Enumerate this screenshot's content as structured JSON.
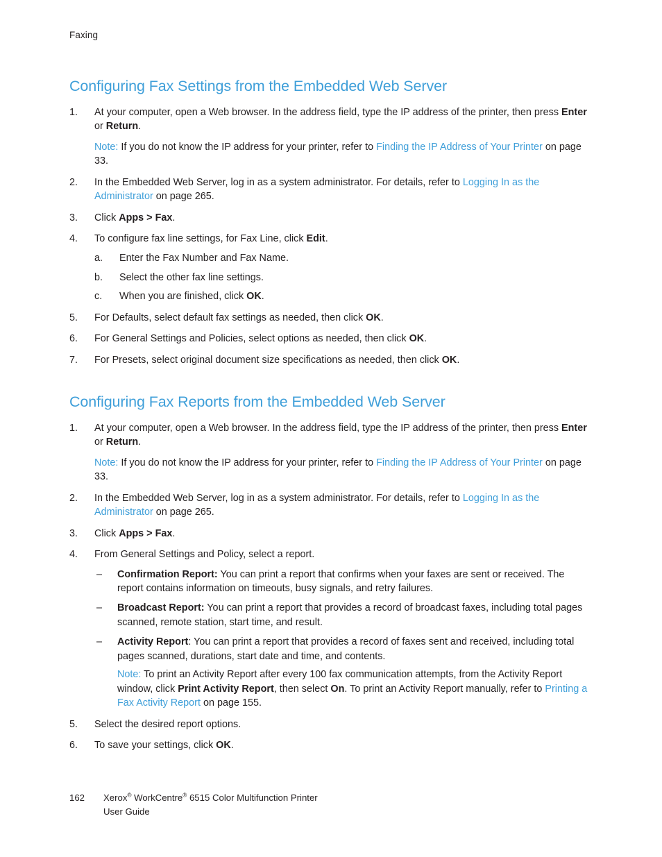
{
  "header": {
    "running_head": "Faxing"
  },
  "colors": {
    "heading_blue": "#3f9fd9",
    "link_blue": "#3f9fd9",
    "body_text": "#231f20"
  },
  "sections": [
    {
      "heading": "Configuring Fax Settings from the Embedded Web Server",
      "steps": [
        {
          "marker": "1.",
          "text_a": "At your computer, open a Web browser. In the address field, type the IP address of the printer, then press ",
          "bold_a": "Enter",
          "text_b": " or ",
          "bold_b": "Return",
          "text_c": ".",
          "note": {
            "label": "Note:",
            "text_a": " If you do not know the IP address for your printer, refer to ",
            "link": "Finding the IP Address of Your Printer",
            "text_b": " on page 33."
          }
        },
        {
          "marker": "2.",
          "text_a": "In the Embedded Web Server, log in as a system administrator. For details, refer to ",
          "link": "Logging In as the Administrator",
          "text_b": " on page 265."
        },
        {
          "marker": "3.",
          "text_a": "Click ",
          "bold_a": "Apps > Fax",
          "text_b": "."
        },
        {
          "marker": "4.",
          "text_a": "To configure fax line settings, for Fax Line, click ",
          "bold_a": "Edit",
          "text_b": ".",
          "substeps": [
            {
              "marker": "a.",
              "text_a": "Enter the Fax Number and Fax Name."
            },
            {
              "marker": "b.",
              "text_a": "Select the other fax line settings."
            },
            {
              "marker": "c.",
              "text_a": "When you are finished, click ",
              "bold_a": "OK",
              "text_b": "."
            }
          ]
        },
        {
          "marker": "5.",
          "text_a": "For Defaults, select default fax settings as needed, then click ",
          "bold_a": "OK",
          "text_b": "."
        },
        {
          "marker": "6.",
          "text_a": "For General Settings and Policies, select options as needed, then click ",
          "bold_a": "OK",
          "text_b": "."
        },
        {
          "marker": "7.",
          "text_a": "For Presets, select original document size specifications as needed, then click ",
          "bold_a": "OK",
          "text_b": "."
        }
      ]
    },
    {
      "heading": "Configuring Fax Reports from the Embedded Web Server",
      "steps": [
        {
          "marker": "1.",
          "text_a": "At your computer, open a Web browser. In the address field, type the IP address of the printer, then press ",
          "bold_a": "Enter",
          "text_b": " or ",
          "bold_b": "Return",
          "text_c": ".",
          "note": {
            "label": "Note:",
            "text_a": " If you do not know the IP address for your printer, refer to ",
            "link": "Finding the IP Address of Your Printer",
            "text_b": " on page 33."
          }
        },
        {
          "marker": "2.",
          "text_a": "In the Embedded Web Server, log in as a system administrator. For details, refer to ",
          "link": "Logging In as the Administrator",
          "text_b": " on page 265."
        },
        {
          "marker": "3.",
          "text_a": "Click ",
          "bold_a": "Apps > Fax",
          "text_b": "."
        },
        {
          "marker": "4.",
          "text_a": "From General Settings and Policy, select a report.",
          "bullets": [
            {
              "marker": "–",
              "bold_a": "Confirmation Report:",
              "text_a": " You can print a report that confirms when your faxes are sent or received. The report contains information on timeouts, busy signals, and retry failures."
            },
            {
              "marker": "–",
              "bold_a": "Broadcast Report:",
              "text_a": " You can print a report that provides a record of broadcast faxes, including total pages scanned, remote station, start time, and result."
            },
            {
              "marker": "–",
              "bold_a": "Activity Report",
              "text_a": ": You can print a report that provides a record of faxes sent and received, including total pages scanned, durations, start date and time, and contents.",
              "note": {
                "label": "Note:",
                "text_a": " To print an Activity Report after every 100 fax communication attempts, from the Activity Report window, click ",
                "bold_a": "Print Activity Report",
                "text_b": ", then select ",
                "bold_b": "On",
                "text_c": ". To print an Activity Report manually, refer to ",
                "link": "Printing a Fax Activity Report",
                "text_d": " on page 155."
              }
            }
          ]
        },
        {
          "marker": "5.",
          "text_a": "Select the desired report options."
        },
        {
          "marker": "6.",
          "text_a": "To save your settings, click ",
          "bold_a": "OK",
          "text_b": "."
        }
      ]
    }
  ],
  "footer": {
    "page_number": "162",
    "product_line_1_a": "Xerox",
    "product_line_1_sup1": "®",
    "product_line_1_b": " WorkCentre",
    "product_line_1_sup2": "®",
    "product_line_1_c": " 6515 Color Multifunction Printer",
    "product_line_2": "User Guide"
  }
}
